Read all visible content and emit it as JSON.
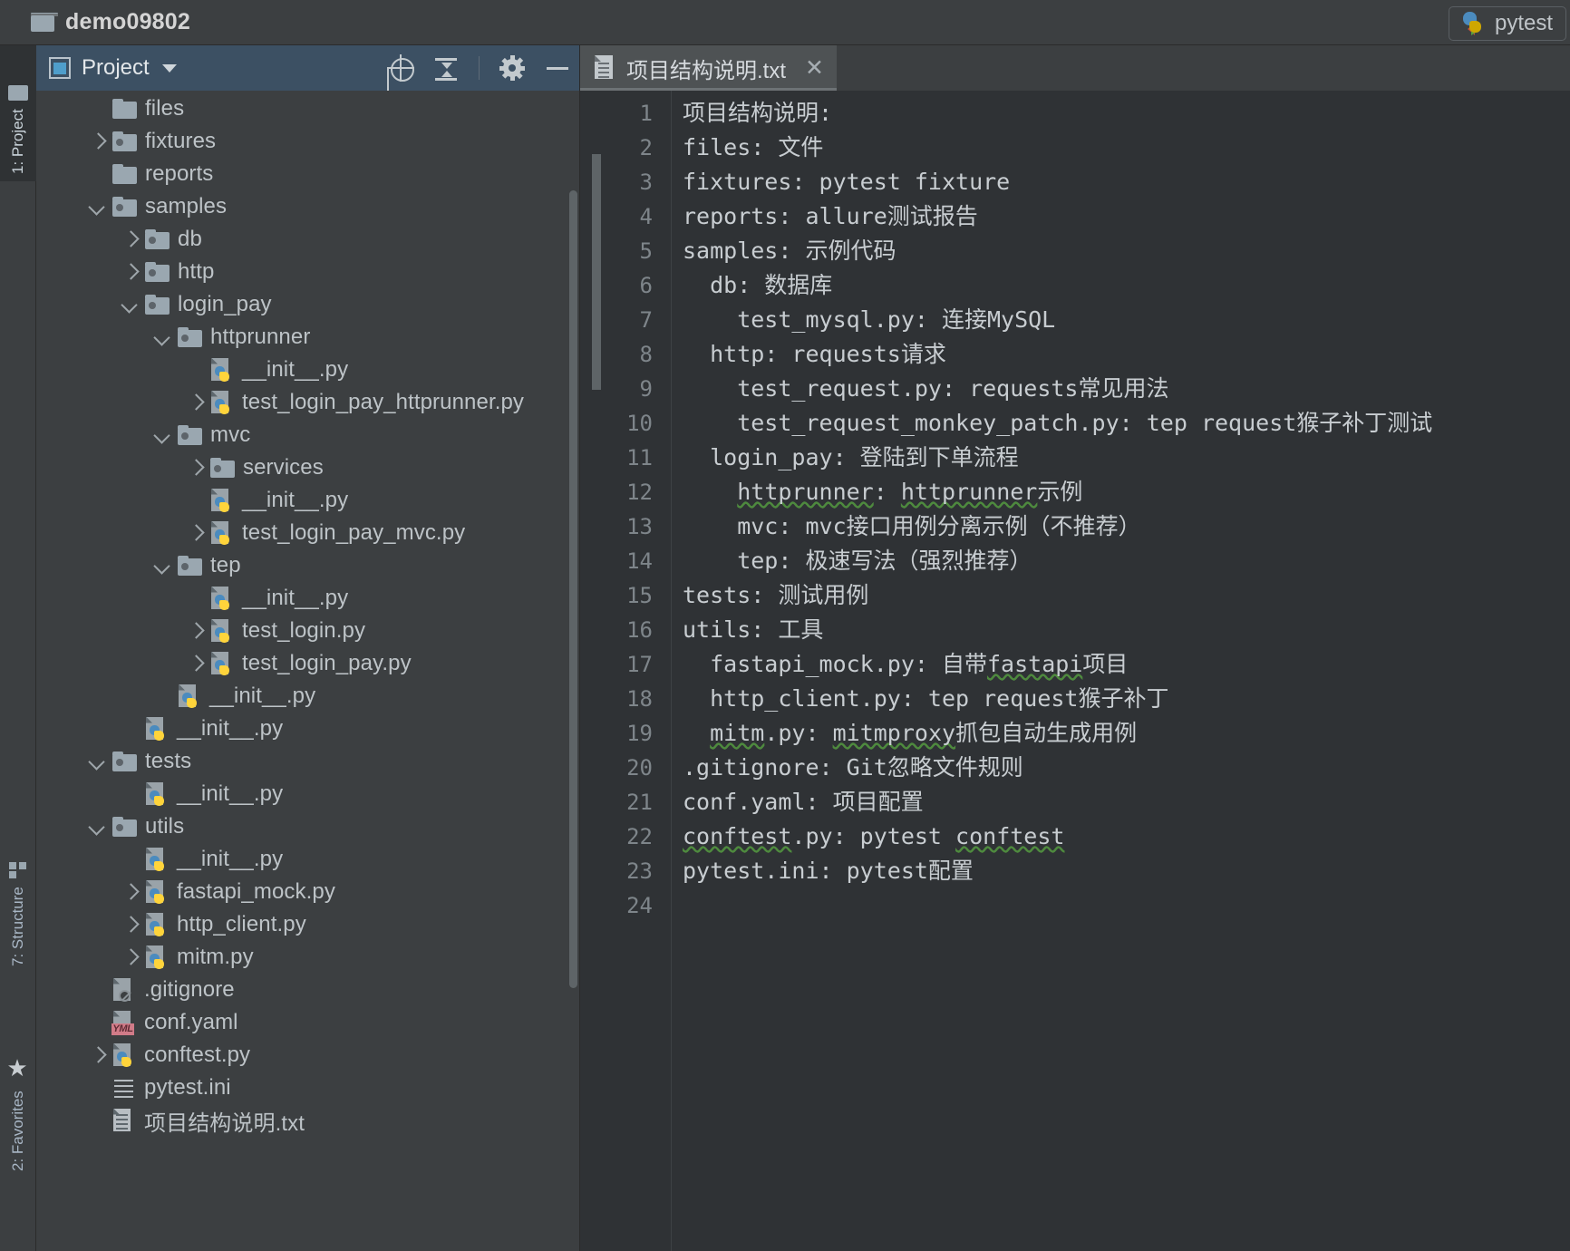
{
  "window": {
    "project_name": "demo09802",
    "folder_icon": "folder-icon"
  },
  "run_config": {
    "label": "pytest",
    "icon": "python-run-icon"
  },
  "sidebar_stripes": {
    "project": "1: Project",
    "structure": "7: Structure",
    "favorites": "2: Favorites"
  },
  "project_panel": {
    "title": "Project",
    "dropdown_icon": "chevron-down-icon",
    "tools": [
      {
        "name": "locate-icon",
        "tooltip": "Select Opened File"
      },
      {
        "name": "collapse-all-icon",
        "tooltip": "Collapse All"
      },
      {
        "name": "gear-icon",
        "tooltip": "Settings"
      },
      {
        "name": "minimize-icon",
        "tooltip": "Hide"
      }
    ],
    "tree": [
      {
        "label": "files",
        "indent": 1,
        "arrow": "none",
        "icon": "folder"
      },
      {
        "label": "fixtures",
        "indent": 1,
        "arrow": "right",
        "icon": "package"
      },
      {
        "label": "reports",
        "indent": 1,
        "arrow": "none",
        "icon": "folder"
      },
      {
        "label": "samples",
        "indent": 1,
        "arrow": "down",
        "icon": "package"
      },
      {
        "label": "db",
        "indent": 2,
        "arrow": "right",
        "icon": "package"
      },
      {
        "label": "http",
        "indent": 2,
        "arrow": "right",
        "icon": "package"
      },
      {
        "label": "login_pay",
        "indent": 2,
        "arrow": "down",
        "icon": "package"
      },
      {
        "label": "httprunner",
        "indent": 3,
        "arrow": "down",
        "icon": "package"
      },
      {
        "label": "__init__.py",
        "indent": 4,
        "arrow": "none",
        "icon": "python"
      },
      {
        "label": "test_login_pay_httprunner.py",
        "indent": 4,
        "arrow": "right",
        "icon": "python"
      },
      {
        "label": "mvc",
        "indent": 3,
        "arrow": "down",
        "icon": "package"
      },
      {
        "label": "services",
        "indent": 4,
        "arrow": "right",
        "icon": "package"
      },
      {
        "label": "__init__.py",
        "indent": 4,
        "arrow": "none",
        "icon": "python"
      },
      {
        "label": "test_login_pay_mvc.py",
        "indent": 4,
        "arrow": "right",
        "icon": "python"
      },
      {
        "label": "tep",
        "indent": 3,
        "arrow": "down",
        "icon": "package"
      },
      {
        "label": "__init__.py",
        "indent": 4,
        "arrow": "none",
        "icon": "python"
      },
      {
        "label": "test_login.py",
        "indent": 4,
        "arrow": "right",
        "icon": "python"
      },
      {
        "label": "test_login_pay.py",
        "indent": 4,
        "arrow": "right",
        "icon": "python"
      },
      {
        "label": "__init__.py",
        "indent": 3,
        "arrow": "none",
        "icon": "python"
      },
      {
        "label": "__init__.py",
        "indent": 2,
        "arrow": "none",
        "icon": "python"
      },
      {
        "label": "tests",
        "indent": 1,
        "arrow": "down",
        "icon": "package"
      },
      {
        "label": "__init__.py",
        "indent": 2,
        "arrow": "none",
        "icon": "python"
      },
      {
        "label": "utils",
        "indent": 1,
        "arrow": "down",
        "icon": "package"
      },
      {
        "label": "__init__.py",
        "indent": 2,
        "arrow": "none",
        "icon": "python"
      },
      {
        "label": "fastapi_mock.py",
        "indent": 2,
        "arrow": "right",
        "icon": "python"
      },
      {
        "label": "http_client.py",
        "indent": 2,
        "arrow": "right",
        "icon": "python"
      },
      {
        "label": "mitm.py",
        "indent": 2,
        "arrow": "right",
        "icon": "python"
      },
      {
        "label": ".gitignore",
        "indent": 1,
        "arrow": "none",
        "icon": "gitignore"
      },
      {
        "label": "conf.yaml",
        "indent": 1,
        "arrow": "none",
        "icon": "yaml"
      },
      {
        "label": "conftest.py",
        "indent": 1,
        "arrow": "right",
        "icon": "python"
      },
      {
        "label": "pytest.ini",
        "indent": 1,
        "arrow": "none",
        "icon": "ini"
      },
      {
        "label": "项目结构说明.txt",
        "indent": 1,
        "arrow": "none",
        "icon": "text"
      }
    ]
  },
  "editor": {
    "tab": {
      "label": "项目结构说明.txt",
      "icon": "text-file-icon",
      "close_icon": "close-icon"
    },
    "line_numbers": [
      1,
      2,
      3,
      4,
      5,
      6,
      7,
      8,
      9,
      10,
      11,
      12,
      13,
      14,
      15,
      16,
      17,
      18,
      19,
      20,
      21,
      22,
      23,
      24
    ],
    "lines": [
      {
        "n": 1,
        "text": "项目结构说明:"
      },
      {
        "n": 2,
        "text": "files: 文件"
      },
      {
        "n": 3,
        "text": "fixtures: pytest fixture"
      },
      {
        "n": 4,
        "text": "reports: allure测试报告"
      },
      {
        "n": 5,
        "text": "samples: 示例代码"
      },
      {
        "n": 6,
        "text": "  db: 数据库"
      },
      {
        "n": 7,
        "text": "    test_mysql.py: 连接MySQL"
      },
      {
        "n": 8,
        "text": "  http: requests请求"
      },
      {
        "n": 9,
        "text": "    test_request.py: requests常见用法"
      },
      {
        "n": 10,
        "text": "    test_request_monkey_patch.py: tep request猴子补丁测试"
      },
      {
        "n": 11,
        "text": "  login_pay: 登陆到下单流程"
      },
      {
        "n": 12,
        "text": "    httprunner: httprunner示例",
        "spell": true
      },
      {
        "n": 13,
        "text": "    mvc: mvc接口用例分离示例（不推荐）"
      },
      {
        "n": 14,
        "text": "    tep: 极速写法（强烈推荐）"
      },
      {
        "n": 15,
        "text": "tests: 测试用例"
      },
      {
        "n": 16,
        "text": "utils: 工具"
      },
      {
        "n": 17,
        "text": "  fastapi_mock.py: 自带fastapi项目",
        "spell": true
      },
      {
        "n": 18,
        "text": "  http_client.py: tep request猴子补丁"
      },
      {
        "n": 19,
        "text": "  mitm.py: mitmproxy抓包自动生成用例",
        "spell": true
      },
      {
        "n": 20,
        "text": ".gitignore: Git忽略文件规则"
      },
      {
        "n": 21,
        "text": "conf.yaml: 项目配置"
      },
      {
        "n": 22,
        "text": "conftest.py: pytest conftest",
        "spell": true
      },
      {
        "n": 23,
        "text": "pytest.ini: pytest配置"
      },
      {
        "n": 24,
        "text": ""
      }
    ]
  },
  "colors": {
    "background": "#3c3f41",
    "editor_background": "#2f3235",
    "panel_header": "#3c5063",
    "text": "#bdc3c7",
    "code_text": "#c8cdd1",
    "line_number": "#7e858a",
    "spell_underline": "#4e8a3e",
    "python_blue": "#4b8bbe",
    "python_yellow": "#ffd43b"
  }
}
